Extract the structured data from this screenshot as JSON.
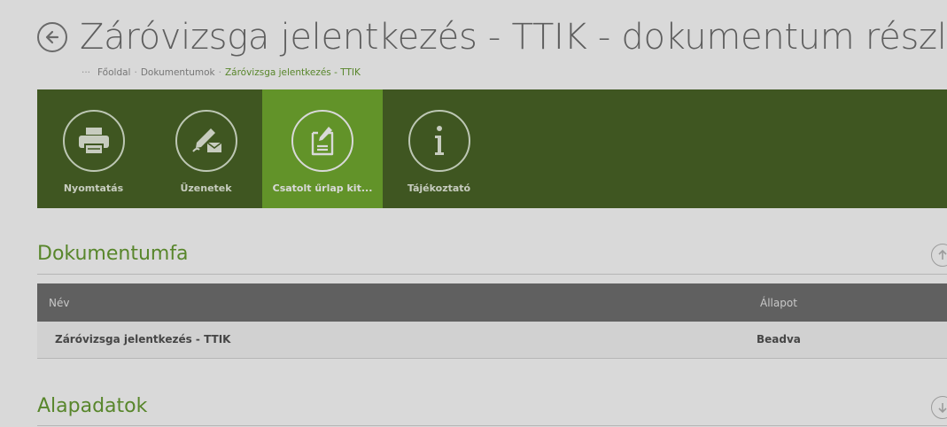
{
  "header": {
    "title": "Záróvizsga jelentkezés - TTIK - dokumentum részletei",
    "back_icon": "back-arrow-icon"
  },
  "breadcrumb": {
    "more": "···",
    "items": [
      "Főoldal",
      "Dokumentumok",
      "Záróvizsga jelentkezés - TTIK"
    ],
    "separator": "·"
  },
  "toolbar": {
    "items": [
      {
        "label": "Nyomtatás",
        "icon": "printer-icon"
      },
      {
        "label": "Üzenetek",
        "icon": "message-icon"
      },
      {
        "label": "Csatolt űrlap kit...",
        "icon": "form-edit-icon",
        "active": true
      },
      {
        "label": "Tájékoztató",
        "icon": "info-icon"
      }
    ],
    "colors": {
      "bar": "#2a4a00",
      "active": "#5a9e0c"
    }
  },
  "document_tree": {
    "title": "Dokumentumfa",
    "columns": {
      "name": "Név",
      "status": "Állapot"
    },
    "rows": [
      {
        "name": "Záróvizsga jelentkezés - TTIK",
        "status": "Beadva"
      }
    ]
  },
  "basic_data": {
    "title": "Alapadatok"
  },
  "colors": {
    "accent": "#4d8c0f"
  }
}
